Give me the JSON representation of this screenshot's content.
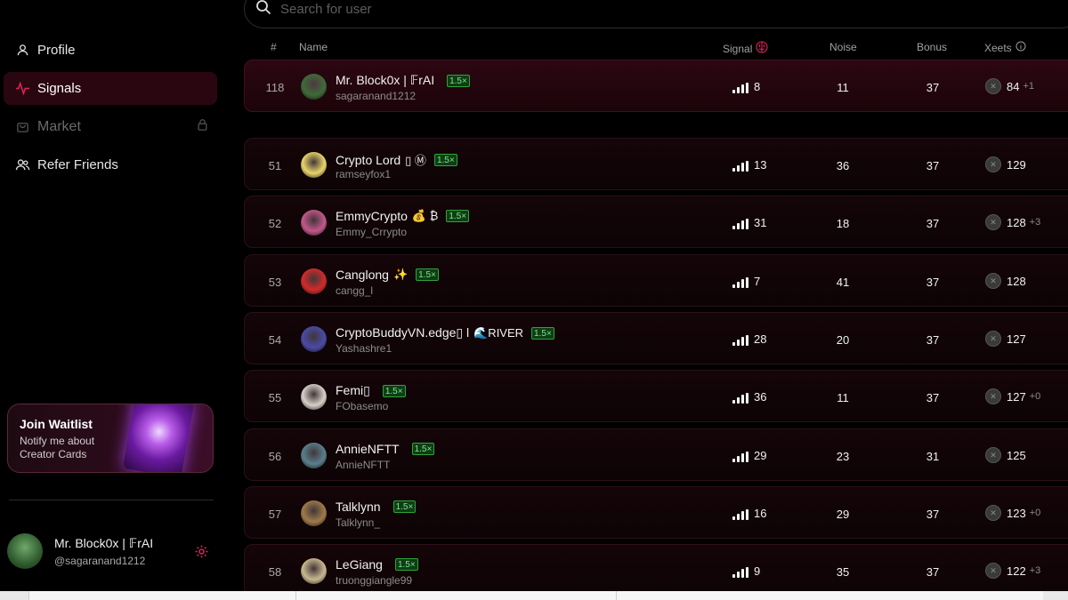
{
  "sidebar": {
    "nav": [
      {
        "label": "Profile",
        "icon": "user-icon",
        "state": "normal"
      },
      {
        "label": "Signals",
        "icon": "pulse-icon",
        "state": "active"
      },
      {
        "label": "Market",
        "icon": "bag-icon",
        "state": "disabled"
      },
      {
        "label": "Refer Friends",
        "icon": "users-icon",
        "state": "normal"
      }
    ],
    "waitlist": {
      "title": "Join Waitlist",
      "subtitle": "Notify me about Creator Cards"
    },
    "user": {
      "name": "Mr. Block0x | 𝔽rAI",
      "handle": "@sagaranand1212"
    }
  },
  "search": {
    "placeholder": "Search for user"
  },
  "table": {
    "headers": {
      "rank": "#",
      "name": "Name",
      "signal": "Signal",
      "noise": "Noise",
      "bonus": "Bonus",
      "xeets": "Xeets"
    },
    "me": {
      "rank": "118",
      "name": "Mr. Block0x | 𝔽rAI",
      "extra": "",
      "badge": "1.5×",
      "handle": "sagaranand1212",
      "signal": "8",
      "noise": "11",
      "bonus": "37",
      "xeets": "84",
      "delta": "+1",
      "avatar": "#3e6b3a"
    },
    "rows": [
      {
        "rank": "51",
        "name": "Crypto Lord",
        "extra": "▯ Ⓜ",
        "badge": "1.5×",
        "handle": "ramseyfox1",
        "signal": "13",
        "noise": "36",
        "bonus": "37",
        "xeets": "129",
        "delta": "",
        "avatar": "#e9d56a"
      },
      {
        "rank": "52",
        "name": "EmmyCrypto",
        "extra": "💰 ₿",
        "badge": "1.5×",
        "handle": "Emmy_Crrypto",
        "signal": "31",
        "noise": "18",
        "bonus": "37",
        "xeets": "128",
        "delta": "+3",
        "avatar": "#c2578a"
      },
      {
        "rank": "53",
        "name": "Canglong",
        "extra": "✨",
        "badge": "1.5×",
        "handle": "cangg_l",
        "signal": "7",
        "noise": "41",
        "bonus": "37",
        "xeets": "128",
        "delta": "",
        "avatar": "#d42a2a"
      },
      {
        "rank": "54",
        "name": "CryptoBuddyVN.edge▯ l",
        "extra": "🌊RIVER",
        "badge": "1.5×",
        "handle": "Yashashre1",
        "signal": "28",
        "noise": "20",
        "bonus": "37",
        "xeets": "127",
        "delta": "",
        "avatar": "#4b4aa8"
      },
      {
        "rank": "55",
        "name": "Femi▯",
        "extra": "",
        "badge": "1.5×",
        "handle": "FObasemo",
        "signal": "36",
        "noise": "11",
        "bonus": "37",
        "xeets": "127",
        "delta": "+0",
        "avatar": "#d8d0c8"
      },
      {
        "rank": "56",
        "name": "AnnieNFTT",
        "extra": "",
        "badge": "1.5×",
        "handle": "AnnieNFTT",
        "signal": "29",
        "noise": "23",
        "bonus": "31",
        "xeets": "125",
        "delta": "",
        "avatar": "#5a7f8c"
      },
      {
        "rank": "57",
        "name": "Talklynn",
        "extra": "",
        "badge": "1.5×",
        "handle": "Talklynn_",
        "signal": "16",
        "noise": "29",
        "bonus": "37",
        "xeets": "123",
        "delta": "+0",
        "avatar": "#a07a4a"
      },
      {
        "rank": "58",
        "name": "LeGiang",
        "extra": "",
        "badge": "1.5×",
        "handle": "truonggiangle99",
        "signal": "9",
        "noise": "35",
        "bonus": "37",
        "xeets": "122",
        "delta": "+3",
        "avatar": "#c8b890"
      }
    ]
  },
  "colors": {
    "accent": "#e0245e",
    "active_bg": "#2a0710",
    "badge_green": "#2fa33a"
  }
}
